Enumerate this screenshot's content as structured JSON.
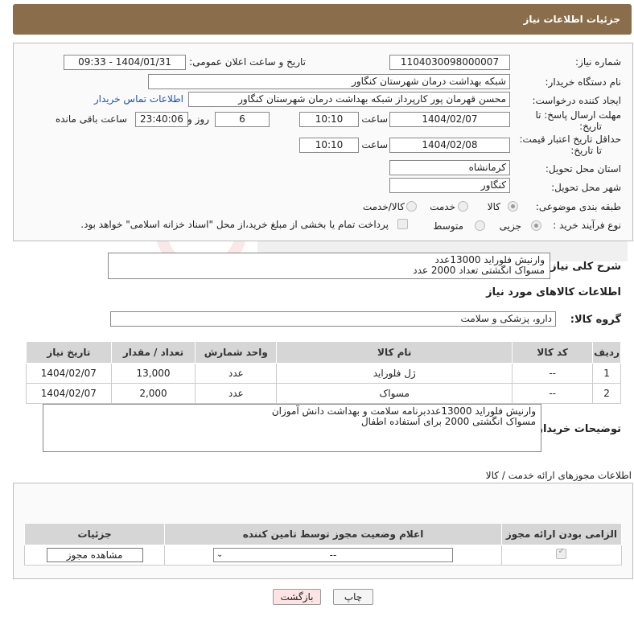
{
  "header": {
    "title": "جزئیات اطلاعات نیاز"
  },
  "form": {
    "need_number_label": "شماره نیاز:",
    "need_number": "1104030098000007",
    "announce_label": "تاریخ و ساعت اعلان عمومی:",
    "announce_value": "1404/01/31 - 09:33",
    "buyer_org_label": "نام دستگاه خریدار:",
    "buyer_org": "شبکه بهداشت درمان شهرستان کنگاور",
    "creator_label": "ایجاد کننده درخواست:",
    "creator": "محسن  قهرمان پور کارپرداز شبکه بهداشت درمان شهرستان کنگاور",
    "contact_link": "اطلاعات تماس خریدار",
    "deadline_label_1": "مهلت ارسال پاسخ: تا",
    "deadline_label_2": "تاریخ:",
    "deadline_date": "1404/02/07",
    "time_label": "ساعت",
    "deadline_time": "10:10",
    "days": "6",
    "days_label": "روز و",
    "remaining_time": "23:40:06",
    "remaining_label": "ساعت باقی مانده",
    "min_price_label_1": "حداقل تاریخ اعتبار قیمت:",
    "min_price_label_2": "تا تاریخ:",
    "min_price_date": "1404/02/08",
    "min_price_time": "10:10",
    "province_label": "استان محل تحویل:",
    "province": "کرمانشاه",
    "city_label": "شهر محل تحویل:",
    "city": "کنگاور",
    "category_label": "طبقه بندی موضوعی:",
    "category_options": [
      "کالا",
      "خدمت",
      "کالا/خدمت"
    ],
    "process_label": "نوع فرآیند خرید :",
    "process_options": [
      "جزیی",
      "متوسط"
    ],
    "payment_note": "پرداخت تمام یا بخشی از مبلغ خرید،از محل \"اسناد خزانه اسلامی\" خواهد بود."
  },
  "summary": {
    "label": "شرح کلی نیاز:",
    "line1": "وارنیش فلوراید 13000عدد",
    "line2": "مسواک انگشتی تعداد 2000 عدد"
  },
  "goods": {
    "section_title": "اطلاعات کالاهای مورد نیاز",
    "group_label": "گروه کالا:",
    "group_value": "دارو، پزشکی و سلامت",
    "columns": [
      "ردیف",
      "کد کالا",
      "نام کالا",
      "واحد شمارش",
      "تعداد / مقدار",
      "تاریخ نیاز"
    ],
    "rows": [
      {
        "idx": "1",
        "code": "--",
        "name": "ژل فلوراید",
        "unit": "عدد",
        "qty": "13,000",
        "date": "1404/02/07"
      },
      {
        "idx": "2",
        "code": "--",
        "name": "مسواک",
        "unit": "عدد",
        "qty": "2,000",
        "date": "1404/02/07"
      }
    ]
  },
  "buyer_notes": {
    "label": "توضیحات خریدار:",
    "line1": "وارنیش فلوراید 13000عددبرنامه سلامت و بهداشت دانش آموزان",
    "line2": "مسواک انگشتی 2000 برای استفاده اطفال"
  },
  "licenses": {
    "section_title": "اطلاعات مجوزهای ارائه خدمت / کالا",
    "columns": [
      "الزامی بودن ارائه مجوز",
      "اعلام وضعیت مجوز توسط تامین کننده",
      "جزئیات"
    ],
    "select_value": "--",
    "view_button": "مشاهده مجوز"
  },
  "buttons": {
    "print": "چاپ",
    "back": "بازگشت"
  },
  "colors": {
    "header_bg": "#8a6e4b",
    "link": "#2255aa",
    "table_header": "#d6d6d6"
  }
}
